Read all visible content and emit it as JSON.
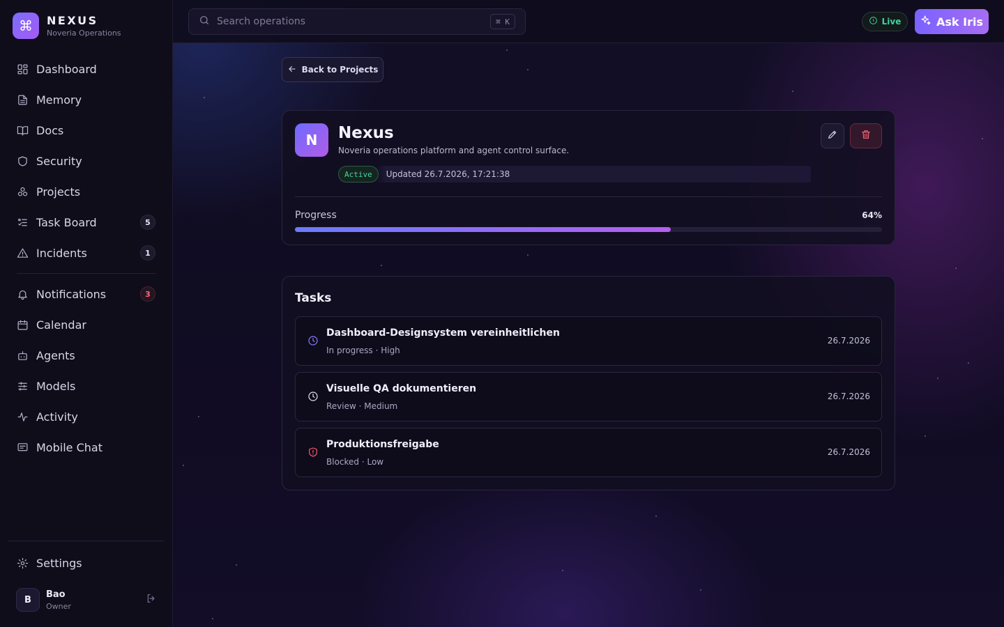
{
  "brand": {
    "logo_glyph": "⌘",
    "name": "NEXUS",
    "subtitle": "Noveria Operations"
  },
  "sidebar": {
    "items": [
      {
        "label": "Dashboard",
        "icon": "dashboard-icon"
      },
      {
        "label": "Memory",
        "icon": "document-icon"
      },
      {
        "label": "Docs",
        "icon": "book-icon"
      },
      {
        "label": "Security",
        "icon": "shield-icon"
      },
      {
        "label": "Projects",
        "icon": "projects-icon"
      },
      {
        "label": "Task Board",
        "icon": "task-list-icon",
        "badge": "5"
      },
      {
        "label": "Incidents",
        "icon": "warning-icon",
        "badge": "1"
      },
      {
        "label": "Notifications",
        "icon": "bell-icon",
        "badge": "3"
      },
      {
        "label": "Calendar",
        "icon": "calendar-icon"
      },
      {
        "label": "Agents",
        "icon": "robot-icon"
      },
      {
        "label": "Models",
        "icon": "sliders-icon"
      },
      {
        "label": "Activity",
        "icon": "activity-icon"
      },
      {
        "label": "Mobile Chat",
        "icon": "chat-icon"
      }
    ],
    "settings_label": "Settings",
    "user": {
      "initial": "B",
      "name": "Bao",
      "role": "Owner"
    }
  },
  "topbar": {
    "search_placeholder": "Search operations",
    "shortcut": "⌘ K",
    "live_label": "Live",
    "ask_label": "Ask Iris"
  },
  "back_label": "Back to Projects",
  "project": {
    "initial": "N",
    "name": "Nexus",
    "description": "Noveria operations platform and agent control surface.",
    "status": "Active",
    "updated": "Updated 26.7.2026, 17:21:38",
    "progress_label": "Progress",
    "progress_text": "64%",
    "progress_value": 0.64
  },
  "tasks": {
    "title": "Tasks",
    "items": [
      {
        "title": "Dashboard-Designsystem vereinheitlichen",
        "meta": "In progress · High",
        "date": "26.7.2026",
        "icon": "clock-icon",
        "color": "#8b7bff"
      },
      {
        "title": "Visuelle QA dokumentieren",
        "meta": "Review · Medium",
        "date": "26.7.2026",
        "icon": "clock-icon",
        "color": "#e6e3f2"
      },
      {
        "title": "Produktionsfreigabe",
        "meta": "Blocked · Low",
        "date": "26.7.2026",
        "icon": "shield-alert-icon",
        "color": "#ff5a6e"
      }
    ]
  },
  "colors": {
    "accent": "#7a62ff",
    "success": "#44d59b",
    "danger": "#ff6b80"
  }
}
